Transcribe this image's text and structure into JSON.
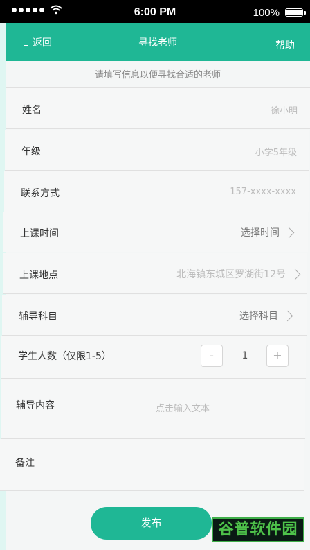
{
  "status_bar": {
    "time": "6:00 PM",
    "battery": "100%"
  },
  "nav": {
    "back_label": "返回",
    "title": "寻找老师",
    "help_label": "帮助"
  },
  "subtitle": "请填写信息以便寻找合适的老师",
  "form": {
    "name": {
      "label": "姓名",
      "value": "徐小明"
    },
    "grade": {
      "label": "年级",
      "value": "小学5年级"
    },
    "contact": {
      "label": "联系方式",
      "value": "157-xxxx-xxxx"
    },
    "time": {
      "label": "上课时间",
      "value": "选择时间"
    },
    "location": {
      "label": "上课地点",
      "value": "北海镇东城区罗湖街12号"
    },
    "subject": {
      "label": "辅导科目",
      "value": "选择科目"
    },
    "students": {
      "label": "学生人数（仅限1-5）",
      "minus": "-",
      "value": "1",
      "plus": "+"
    },
    "content": {
      "label": "辅导内容",
      "placeholder": "点击输入文本"
    },
    "remarks": {
      "label": "备注"
    }
  },
  "publish_label": "发布",
  "watermark": "谷普软件园",
  "colors": {
    "accent": "#1fb795"
  }
}
